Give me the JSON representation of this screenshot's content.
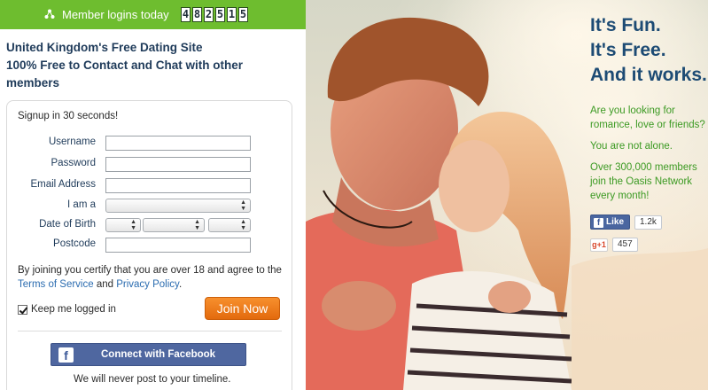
{
  "topbar": {
    "logins_label": "Member logins today",
    "counter_digits": [
      "4",
      "8",
      "2",
      "5",
      "1",
      "5"
    ],
    "accent": "#6ebd2f"
  },
  "headline": {
    "line1": "United Kingdom's Free Dating Site",
    "line2": "100% Free to Contact and Chat with other members"
  },
  "form": {
    "signup_note": "Signup in 30 seconds!",
    "fields": {
      "username_label": "Username",
      "password_label": "Password",
      "email_label": "Email Address",
      "iam_label": "I am a",
      "dob_label": "Date of Birth",
      "postcode_label": "Postcode"
    },
    "terms_text": "By joining you certify that you are over 18 and agree to the",
    "terms_link": "Terms of Service",
    "and_text": " and ",
    "privacy_link": "Privacy Policy",
    "period": ".",
    "keep_logged_in": "Keep me logged in",
    "join_button": "Join Now",
    "join_color": "#f07f1f",
    "facebook_button": "Connect with Facebook",
    "facebook_icon": "f",
    "never_post": "We will never post to your timeline."
  },
  "hero": {
    "tagline_1": "It's Fun.",
    "tagline_2": "It's Free.",
    "tagline_3": "And it works.",
    "blurb_1": "Are you looking for romance, love or friends?",
    "blurb_2": "You are not alone.",
    "blurb_3": "Over 300,000 members join the Oasis Network every month!",
    "like_label": "Like",
    "like_count": "1.2k",
    "gplus_label": "g+1",
    "gplus_count": "457",
    "text_green": "#3c9a23",
    "text_blue": "#1d4b74"
  }
}
